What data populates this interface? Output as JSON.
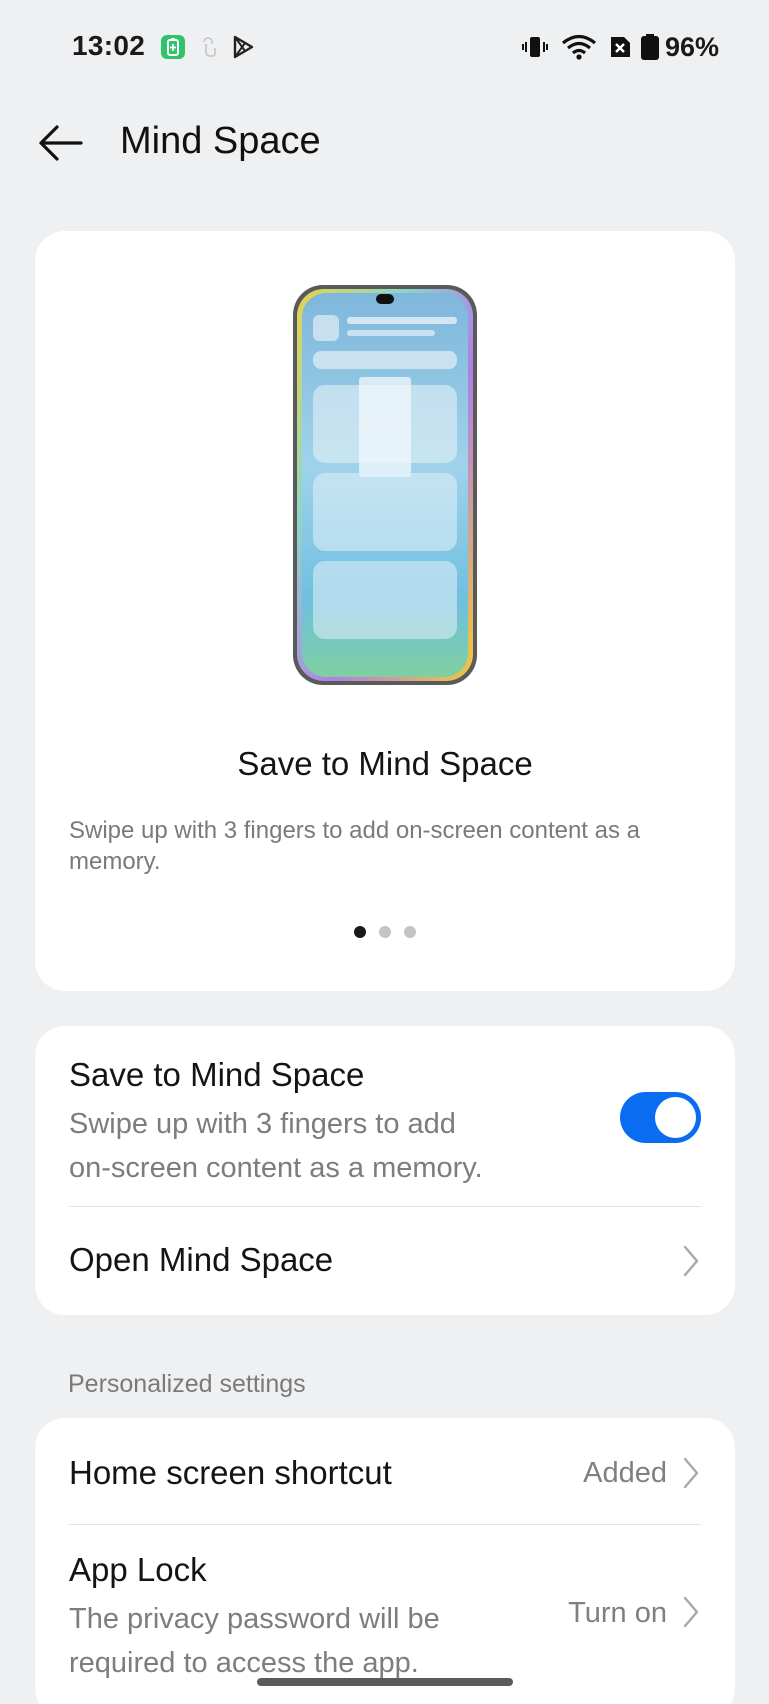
{
  "status_bar": {
    "time": "13:02",
    "left_icons": [
      "battery-saver-icon",
      "touch-icon",
      "play-store-icon"
    ],
    "right_icons": [
      "vibrate-icon",
      "wifi-icon",
      "no-sim-icon",
      "battery-icon"
    ],
    "battery_percent": "96%"
  },
  "header": {
    "back_icon": "back-arrow-icon",
    "title": "Mind Space"
  },
  "hero": {
    "title": "Save to Mind Space",
    "description": "Swipe up with 3 fingers to add on-screen content as a memory.",
    "pager_total": 3,
    "pager_active": 1
  },
  "main_settings": {
    "save_to_mind_space": {
      "title": "Save to Mind Space",
      "subtitle_line1": "Swipe up with 3 fingers to add",
      "subtitle_line2": "on-screen content as a memory.",
      "enabled": true
    },
    "open_mind_space": {
      "title": "Open Mind Space"
    }
  },
  "personalized": {
    "section_label": "Personalized settings",
    "home_screen_shortcut": {
      "title": "Home screen shortcut",
      "value": "Added"
    },
    "app_lock": {
      "title": "App Lock",
      "subtitle_line1": "The privacy password will be",
      "subtitle_line2": "required to access the app.",
      "value": "Turn on"
    }
  },
  "colors": {
    "background": "#eff0f2",
    "card": "#ffffff",
    "accent": "#0a6cf0",
    "secondary_text": "#7d7d7d"
  }
}
